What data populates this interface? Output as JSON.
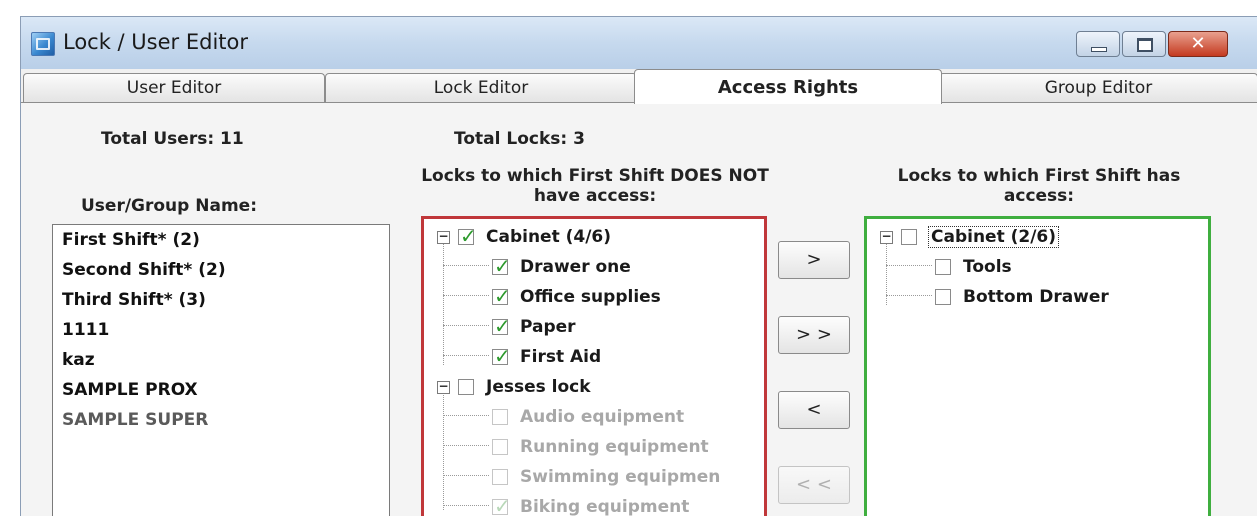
{
  "window": {
    "title": "Lock / User Editor",
    "icons": {
      "app": "app-icon",
      "minimize": "minimize-icon",
      "maximize": "maximize-icon",
      "close": "close-icon"
    },
    "close_glyph": "✕"
  },
  "tabs": [
    {
      "label": "User Editor",
      "active": false
    },
    {
      "label": "Lock Editor",
      "active": false
    },
    {
      "label": "Access Rights",
      "active": true
    },
    {
      "label": "Group Editor",
      "active": false
    }
  ],
  "totals": {
    "users": "Total Users: 11",
    "locks": "Total Locks: 3"
  },
  "labels": {
    "user_group_name": "User/Group Name:",
    "no_access_line1": "Locks to which First Shift DOES NOT",
    "no_access_line2": "have access:",
    "has_access_line1": "Locks to which First Shift has",
    "has_access_line2": "access:"
  },
  "users": [
    "First Shift* (2)",
    "Second Shift* (2)",
    "Third Shift* (3)",
    "1111",
    "kaz",
    "SAMPLE PROX",
    "SAMPLE SUPER"
  ],
  "no_access_tree": {
    "cabinet": {
      "label": "Cabinet (4/6)",
      "checked": true,
      "expanded": true
    },
    "cabinet_children": [
      {
        "label": "Drawer one",
        "checked": true
      },
      {
        "label": "Office supplies",
        "checked": true
      },
      {
        "label": "Paper",
        "checked": true
      },
      {
        "label": "First Aid",
        "checked": true
      }
    ],
    "jesses": {
      "label": "Jesses lock",
      "checked": false,
      "expanded": true
    },
    "jesses_children": [
      {
        "label": "Audio equipment",
        "checked": false,
        "enabled": false
      },
      {
        "label": "Running equipment",
        "checked": false,
        "enabled": false
      },
      {
        "label": "Swimming equipmen",
        "checked": false,
        "enabled": false
      },
      {
        "label": "Biking equipment",
        "checked": true,
        "enabled": false
      }
    ]
  },
  "has_access_tree": {
    "cabinet": {
      "label": "Cabinet (2/6)",
      "checked": false,
      "expanded": true
    },
    "cabinet_children": [
      {
        "label": "Tools",
        "checked": false
      },
      {
        "label": "Bottom Drawer",
        "checked": false
      }
    ]
  },
  "move_buttons": {
    "add": ">",
    "add_all": "> >",
    "remove": "<",
    "remove_all": "< <"
  },
  "glyphs": {
    "expanded": "−",
    "tick": "✓"
  },
  "colors": {
    "no_access_border": "#c0373a",
    "has_access_border": "#3fae3f",
    "check_mark": "#2c9a2c",
    "disabled_text": "#a8a8a8"
  }
}
